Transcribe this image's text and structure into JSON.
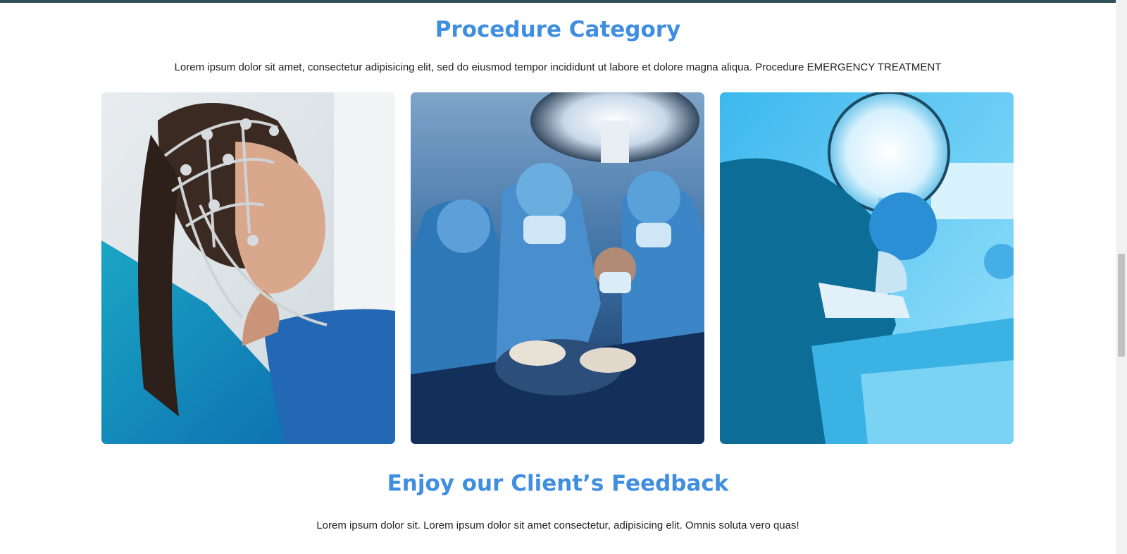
{
  "procedure": {
    "title": "Procedure Category",
    "description": "Lorem ipsum dolor sit amet, consectetur adipisicing elit, sed do eiusmod tempor incididunt ut labore et dolore magna aliqua. Procedure EMERGENCY TREATMENT",
    "images": [
      {
        "icon": "eeg-patient-image"
      },
      {
        "icon": "surgical-team-image"
      },
      {
        "icon": "surgeon-operating-image"
      }
    ]
  },
  "feedback": {
    "title": "Enjoy our Client’s Feedback",
    "description": "Lorem ipsum dolor sit. Lorem ipsum dolor sit amet consectetur, adipisicing elit. Omnis soluta vero quas!"
  },
  "colors": {
    "heading": "#3f8ee0",
    "top_bar": "#2f4f56"
  }
}
